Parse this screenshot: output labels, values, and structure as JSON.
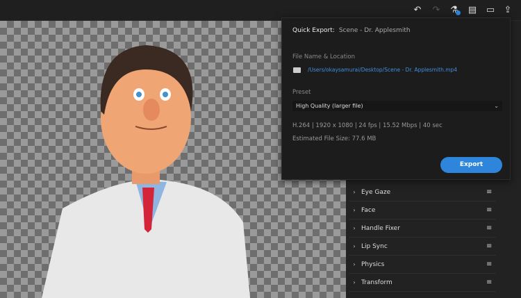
{
  "toolbar": {
    "icons": [
      "undo-icon",
      "redo-icon",
      "flask-icon",
      "comment-icon",
      "panel-icon",
      "share-icon"
    ]
  },
  "popup": {
    "title": "Quick Export:",
    "scene": "Scene - Dr. Applesmith",
    "file_label": "File Name & Location",
    "file_path": "/Users/okaysamurai/Desktop/Scene - Dr. Applesmith.mp4",
    "preset_label": "Preset",
    "preset_value": "High Quality (larger file)",
    "specs": "H.264 | 1920 x 1080 | 24 fps | 15.52 Mbps | 40 sec",
    "file_size": "Estimated File Size: 77.6 MB",
    "export_label": "Export"
  },
  "panel": {
    "items": [
      {
        "label": "Eye Gaze"
      },
      {
        "label": "Face"
      },
      {
        "label": "Handle Fixer"
      },
      {
        "label": "Lip Sync"
      },
      {
        "label": "Physics"
      },
      {
        "label": "Transform"
      }
    ]
  },
  "colors": {
    "accent": "#2d86dc",
    "link": "#3f8fe0"
  }
}
